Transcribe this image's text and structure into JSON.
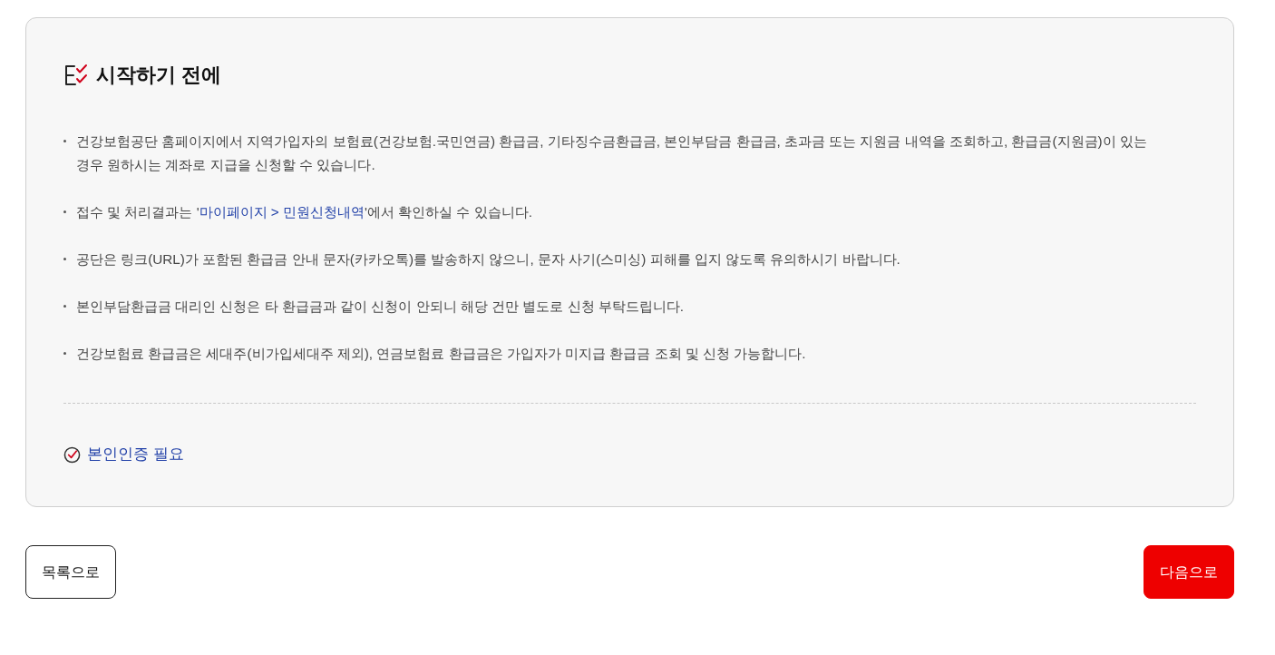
{
  "section": {
    "title": "시작하기 전에",
    "notices": [
      {
        "kind": "plain",
        "text": "건강보험공단 홈페이지에서 지역가입자의 보험료(건강보험.국민연금) 환급금, 기타징수금환급금, 본인부담금 환급금, 초과금 또는 지원금 내역을 조회하고, 환급금(지원금)이 있는 경우 원하시는 계좌로 지급을 신청할 수 있습니다."
      },
      {
        "kind": "highlight",
        "before": "접수 및 처리결과는 '",
        "highlight": "마이페이지 > 민원신청내역",
        "after": "'에서 확인하실 수 있습니다."
      },
      {
        "kind": "plain",
        "text": "공단은 링크(URL)가 포함된 환급금 안내 문자(카카오톡)를 발송하지 않으니, 문자 사기(스미싱) 피해를 입지 않도록 유의하시기 바랍니다."
      },
      {
        "kind": "plain",
        "text": "본인부담환급금 대리인 신청은 타 환급금과 같이 신청이 안되니 해당 건만 별도로 신청 부탁드립니다."
      },
      {
        "kind": "plain",
        "text": "건강보험료 환급금은 세대주(비가입세대주 제외), 연금보험료 환급금은 가입자가 미지급 환급금 조회 및 신청 가능합니다."
      }
    ],
    "requirement": "본인인증 필요"
  },
  "buttons": [
    {
      "kind": "secondary",
      "label": "목록으로"
    },
    {
      "kind": "primary",
      "label": "다음으로"
    }
  ]
}
